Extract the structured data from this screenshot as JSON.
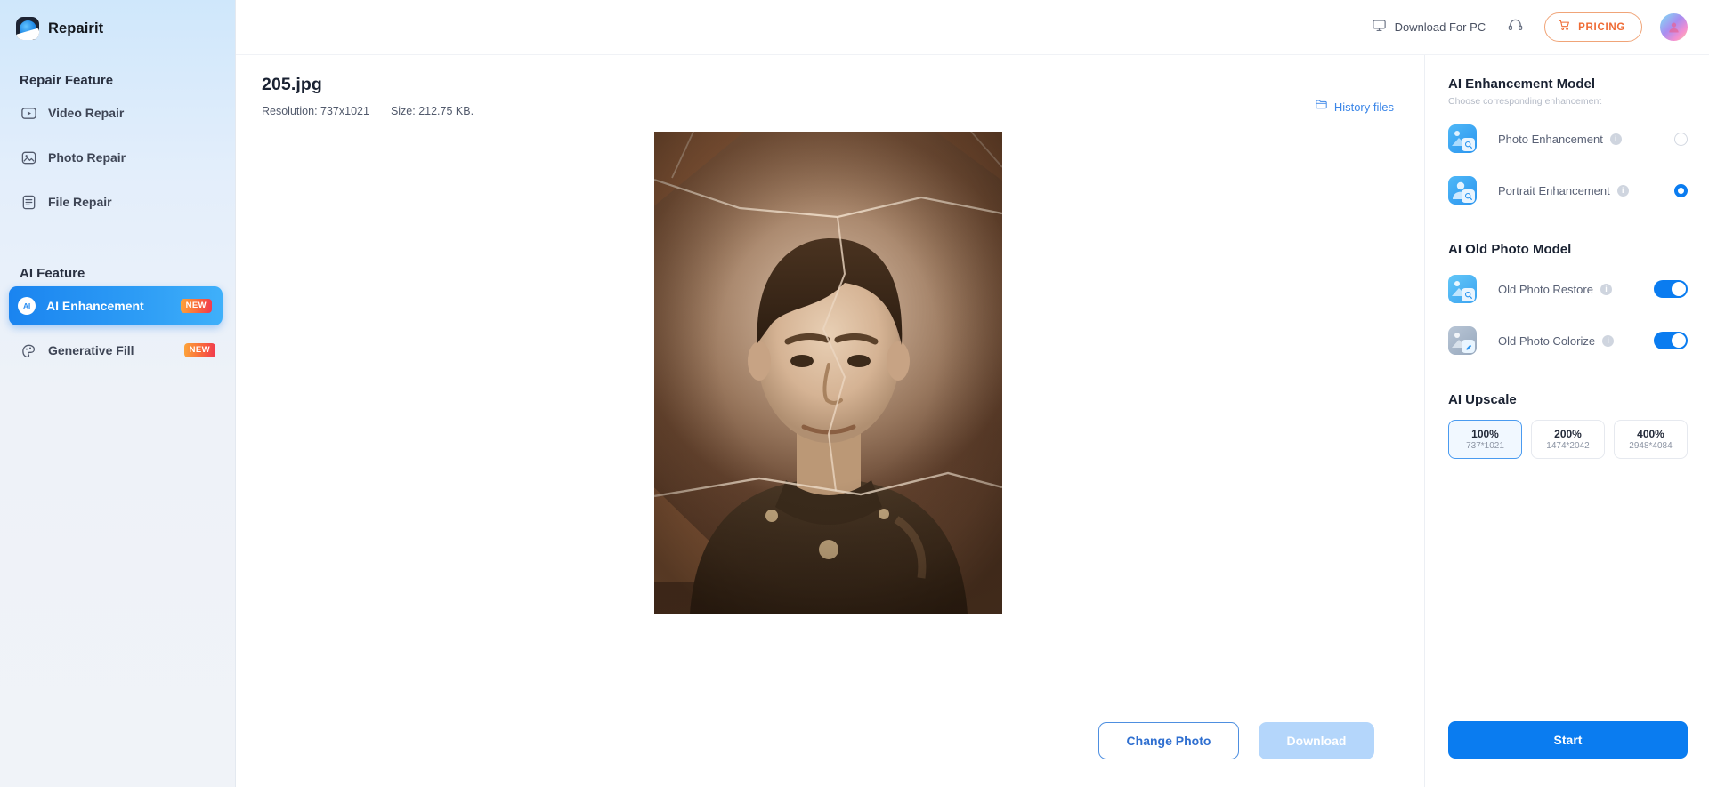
{
  "app": {
    "name": "Repairit",
    "logo_icon": "repairit-logo-icon"
  },
  "sidebar": {
    "sections": [
      {
        "title": "Repair Feature",
        "items": [
          {
            "label": "Video Repair",
            "icon": "video-repair-icon",
            "active": false,
            "badge": ""
          },
          {
            "label": "Photo Repair",
            "icon": "photo-repair-icon",
            "active": false,
            "badge": ""
          },
          {
            "label": "File Repair",
            "icon": "file-repair-icon",
            "active": false,
            "badge": ""
          }
        ]
      },
      {
        "title": "AI Feature",
        "items": [
          {
            "label": "AI Enhancement",
            "icon": "ai-enhancement-icon",
            "active": true,
            "badge": "NEW"
          },
          {
            "label": "Generative Fill",
            "icon": "generative-fill-icon",
            "active": false,
            "badge": "NEW"
          }
        ]
      }
    ]
  },
  "topbar": {
    "download_for_pc": "Download For PC",
    "download_icon": "monitor-icon",
    "support_icon": "headset-icon",
    "pricing_label": "PRICING",
    "pricing_icon": "cart-icon",
    "avatar_icon": "user-avatar-icon"
  },
  "file": {
    "name": "205.jpg",
    "resolution_label": "Resolution: 737x1021",
    "size_label": "Size: 212.75 KB.",
    "history_label": "History files",
    "history_icon": "folder-icon"
  },
  "preview": {
    "alt": "vintage sepia portrait of a young man in military uniform with cracks across the photo"
  },
  "footer": {
    "change_photo": "Change Photo",
    "download": "Download"
  },
  "panel": {
    "enhancement": {
      "title": "AI Enhancement Model",
      "subtitle": "Choose corresponding enhancement",
      "options": [
        {
          "label": "Photo Enhancement",
          "icon": "photo-enhancement-icon",
          "selected": false
        },
        {
          "label": "Portrait Enhancement",
          "icon": "portrait-enhancement-icon",
          "selected": true
        }
      ]
    },
    "old_photo": {
      "title": "AI Old Photo Model",
      "options": [
        {
          "label": "Old Photo Restore",
          "icon": "old-photo-restore-icon",
          "enabled": true
        },
        {
          "label": "Old Photo Colorize",
          "icon": "old-photo-colorize-icon",
          "enabled": true
        }
      ]
    },
    "upscale": {
      "title": "AI Upscale",
      "options": [
        {
          "pct": "100%",
          "dims": "737*1021",
          "selected": true
        },
        {
          "pct": "200%",
          "dims": "1474*2042",
          "selected": false
        },
        {
          "pct": "400%",
          "dims": "2948*4084",
          "selected": false
        }
      ]
    },
    "start_label": "Start"
  },
  "colors": {
    "accent_blue": "#0a7cf0",
    "pricing_orange": "#ef6b35",
    "badge_gradient_start": "#fca53a",
    "badge_gradient_end": "#f0384f",
    "sidebar_active": "#1a84f0"
  }
}
